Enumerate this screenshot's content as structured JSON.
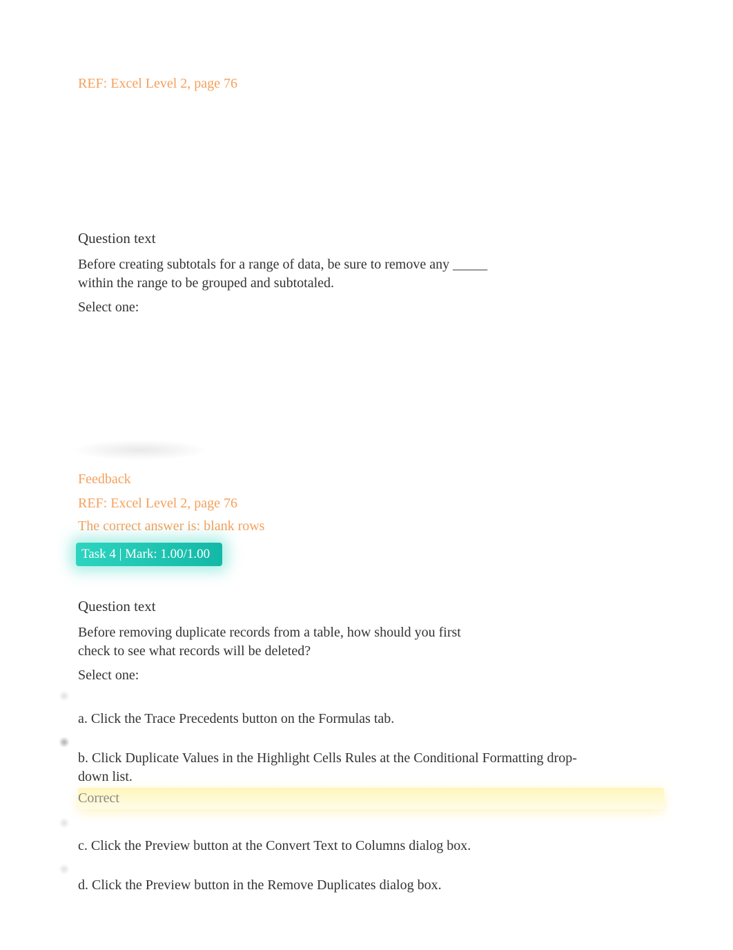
{
  "ref1": "REF: Excel Level 2, page 76",
  "q1": {
    "header": "Question text",
    "body": "Before creating subtotals for a range of data, be sure to remove any _____ within the range to be grouped and subtotaled.",
    "selectOne": "Select one:"
  },
  "feedback": {
    "label": "Feedback",
    "ref": "REF: Excel Level 2, page 76",
    "correctAnswer": "The correct answer is: blank rows"
  },
  "taskBadge": "Task 4 | Mark: 1.00/1.00",
  "q2": {
    "header": "Question text",
    "body": "Before removing duplicate records from a table, how should you first check to see what records will be deleted?",
    "selectOne": "Select one:",
    "options": {
      "a": "a. Click the Trace Precedents button on the Formulas tab.",
      "b": "b. Click   Duplicate Values        in the   Highlight Cells Rules        at the Conditional Formatting drop-down list.",
      "c": "c. Click the Preview button at the Convert Text to Columns dialog box.",
      "d": "d. Click the Preview button in the Remove Duplicates dialog box."
    },
    "correctLabel": "Correct"
  }
}
